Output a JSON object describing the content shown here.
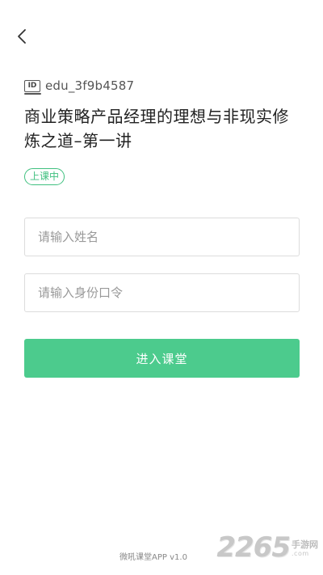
{
  "header": {
    "back_icon": "chevron-left-icon"
  },
  "course": {
    "id_badge": "ID",
    "id": "edu_3f9b4587",
    "title": "商业策略产品经理的理想与非现实修炼之道–第一讲",
    "status": "上课中"
  },
  "form": {
    "name_placeholder": "请输入姓名",
    "password_placeholder": "请输入身份口令",
    "enter_label": "进入课堂"
  },
  "footer": {
    "version": "微吼课堂APP v1.0"
  },
  "watermark": {
    "digits": "2265",
    "cn": "手游网",
    "com": ".com"
  },
  "colors": {
    "accent": "#4ccb8d",
    "status": "#3fc07f"
  }
}
